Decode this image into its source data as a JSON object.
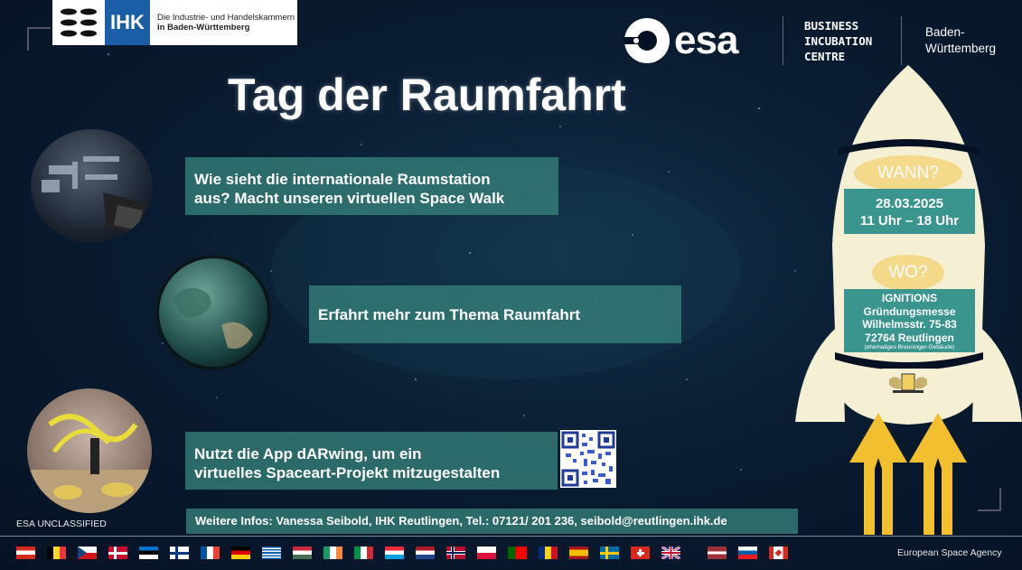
{
  "header": {
    "ihk_box": "IHK",
    "ihk_text_line1": "Die Industrie- und Handelskammern",
    "ihk_text_line2": "in Baden-Württemberg",
    "esa_word": "esa",
    "bic_line1": "BUSINESS",
    "bic_line2": "INCUBATION",
    "bic_line3": "CENTRE",
    "bw_line1": "Baden-",
    "bw_line2": "Württemberg"
  },
  "title": "Tag der Raumfahrt",
  "boxes": {
    "spacewalk_line1": "Wie sieht die internationale Raumstation",
    "spacewalk_line2": "aus? Macht unseren virtuellen Space Walk",
    "raumfahrt": "Erfahrt mehr zum Thema Raumfahrt",
    "darwing_line1": "Nutzt die App dARwing, um ein",
    "darwing_line2": "virtuelles Spaceart-Projekt mitzugestalten",
    "info": "Weitere Infos: Vanessa Seibold, IHK Reutlingen, Tel.: 07121/ 201 236, seibold@reutlingen.ihk.de"
  },
  "rocket": {
    "wann": "WANN?",
    "date": "28.03.2025",
    "time": "11 Uhr – 18 Uhr",
    "wo": "WO?",
    "venue_line1": "IGNITIONS",
    "venue_line2": "Gründungsmesse",
    "venue_line3": "Wilhelmsstr. 75-83",
    "venue_line4": "72764 Reutlingen",
    "venue_note": "(ehemaliges Breuninger-Gebäude)"
  },
  "footer": {
    "classification": "ESA UNCLASSIFIED",
    "agency": "European Space Agency"
  },
  "colors": {
    "teal_box": "#347d78",
    "rocket_cream": "#f5efd4",
    "oval": "#f5d98a",
    "arrow": "#f2bf2e"
  }
}
